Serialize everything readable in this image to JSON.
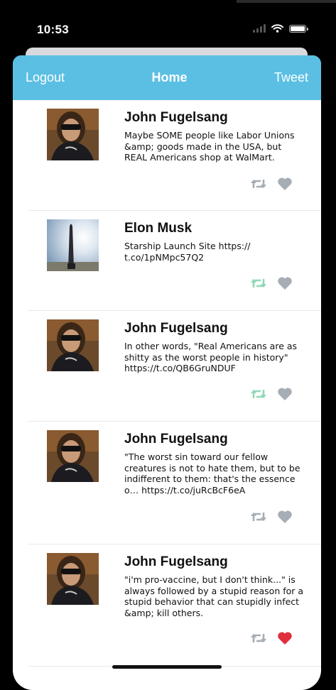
{
  "status": {
    "time": "10:53"
  },
  "nav": {
    "left": "Logout",
    "title": "Home",
    "right": "Tweet"
  },
  "colors": {
    "navbar": "#5bbfe3",
    "retweet_active": "#8fd9b6",
    "icon_inactive": "#a6adb5",
    "like_active": "#e0303f"
  },
  "tweets": [
    {
      "name": "John Fugelsang",
      "text": "Maybe SOME people like Labor Unions &amp; goods made in the USA, but REAL Americans shop at WalMart.",
      "avatar": "person-avatar",
      "retweeted": false,
      "liked": false
    },
    {
      "name": "Elon Musk",
      "text": "Starship Launch Site https:// t.co/1pNMpc57Q2",
      "avatar": "rocket-avatar",
      "retweeted": true,
      "liked": false
    },
    {
      "name": "John Fugelsang",
      "text": "In other words, \"Real Americans are as shitty as the worst people in history\" https://t.co/QB6GruNDUF",
      "avatar": "person-avatar",
      "retweeted": true,
      "liked": false
    },
    {
      "name": "John Fugelsang",
      "text": "\"The worst sin toward our fellow creatures is not to hate them, but to be indifferent to them: that's the essence o… https://t.co/juRcBcF6eA",
      "avatar": "person-avatar",
      "retweeted": false,
      "liked": false
    },
    {
      "name": "John Fugelsang",
      "text": "\"i'm pro-vaccine, but I don't think...\" is always followed by a stupid reason for a stupid behavior that can stupidly infect &amp; kill others.",
      "avatar": "person-avatar",
      "retweeted": false,
      "liked": true
    }
  ]
}
